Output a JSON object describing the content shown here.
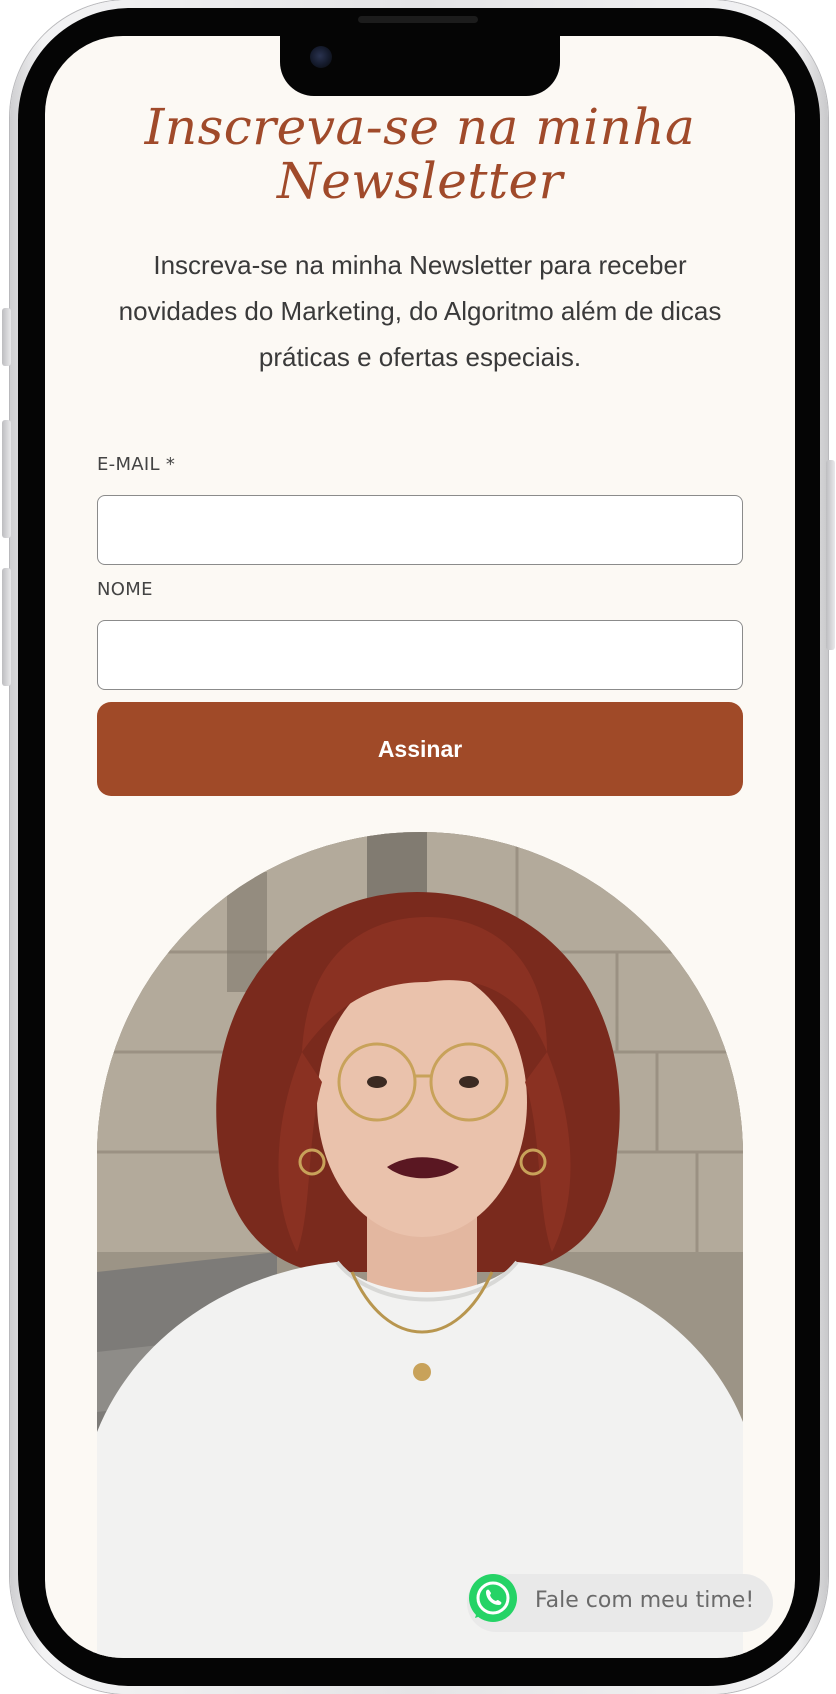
{
  "page": {
    "headline": "Inscreva-se na minha Newsletter",
    "intro": "Inscreva-se na minha Newsletter para receber novidades do Marketing, do Algoritmo além de dicas práticas e ofertas especiais."
  },
  "form": {
    "email_label": "E-MAIL *",
    "email_value": "",
    "name_label": "NOME",
    "name_value": "",
    "submit_label": "Assinar"
  },
  "portrait": {
    "icon": "portrait-photo"
  },
  "whatsapp": {
    "label": "Fale com meu time!",
    "icon": "whatsapp-icon",
    "color": "#25d366"
  },
  "colors": {
    "accent": "#a04a28",
    "background": "#fcf9f4",
    "text": "#3a3a3a"
  }
}
